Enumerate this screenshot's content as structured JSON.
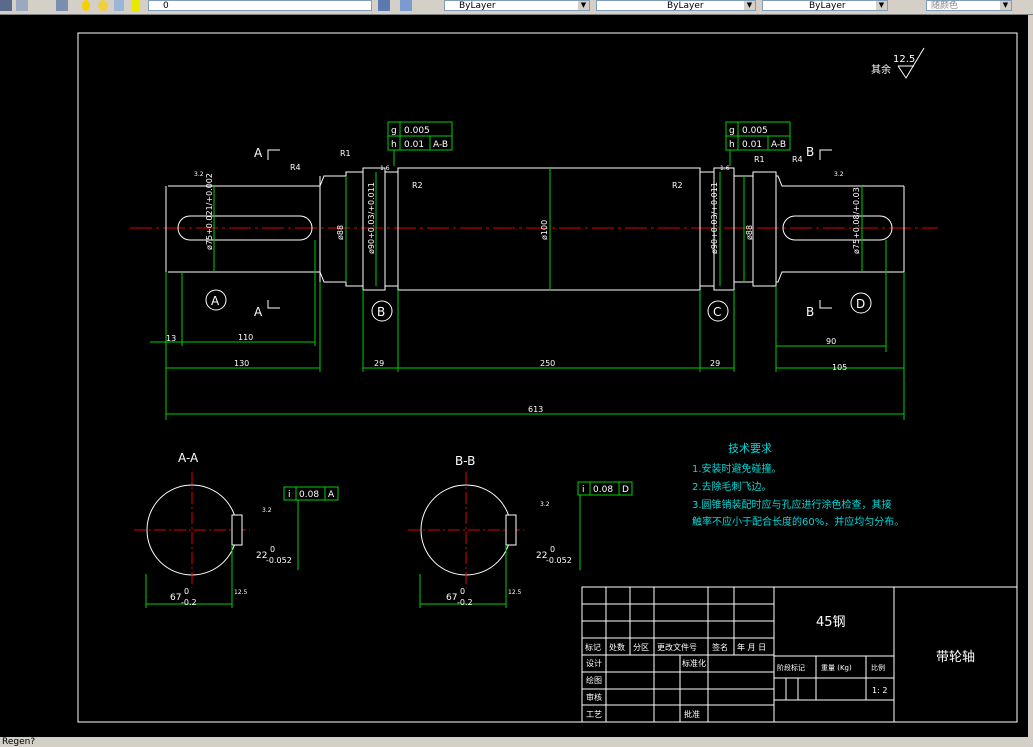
{
  "toolbar": {
    "layer_value": "0",
    "color_combo": "ByLayer",
    "linetype_combo": "ByLayer",
    "lineweight_combo": "ByLayer",
    "plotstyle_combo": "随颜色"
  },
  "drawing": {
    "roughness_note": {
      "prefix": "其余",
      "value": "12.5"
    },
    "section_marks": {
      "a_top": "A",
      "a_bottom": "A",
      "b_top": "B",
      "b_bottom": "B"
    },
    "datums": [
      "A",
      "B",
      "C",
      "D"
    ],
    "radii": {
      "r4_left": "R4",
      "r1_left": "R1",
      "r2_left": "R2",
      "r2_right": "R2",
      "r1_right": "R1",
      "r4_right": "R4"
    },
    "tolerance_left": {
      "row1_sym": "g",
      "row1_val": "0.005",
      "row2_sym": "h",
      "row2_val": "0.01",
      "row2_ref": "A-B"
    },
    "tolerance_right": {
      "row1_sym": "g",
      "row1_val": "0.005",
      "row2_sym": "h",
      "row2_val": "0.01",
      "row2_ref": "A-B"
    },
    "diameters": {
      "left_end": "ø75+0.021/+0.002",
      "left_shoulder": "ø88",
      "left_bearing": "ø90+0.03/+0.011",
      "middle": "ø100",
      "right_bearing": "ø90+0.03/+0.011",
      "right_shoulder": "ø88",
      "right_end": "ø75+0.08/+0.03"
    },
    "lengths": {
      "d13": "13",
      "d110": "110",
      "d130": "130",
      "d29_left": "29",
      "d250": "250",
      "d29_right": "29",
      "d90": "90",
      "d105": "105",
      "d613": "613"
    },
    "surface_marks": {
      "s1": "3.2",
      "s2": "1.6",
      "s3": "1.6",
      "s4": "3.2"
    },
    "section_aa": {
      "title": "A-A",
      "tol_sym": "i",
      "tol_val": "0.08",
      "tol_ref": "A",
      "depth_nominal": "22",
      "depth_upper": "0",
      "depth_lower": "-0.052",
      "width_nominal": "67",
      "width_upper": "0",
      "width_lower": "-0.2",
      "rough_left": "3.2",
      "rough_right": "12.5"
    },
    "section_bb": {
      "title": "B-B",
      "tol_sym": "i",
      "tol_val": "0.08",
      "tol_ref": "D",
      "depth_nominal": "22",
      "depth_upper": "0",
      "depth_lower": "-0.052",
      "width_nominal": "67",
      "width_upper": "0",
      "width_lower": "-0.2",
      "rough_left": "3.2",
      "rough_right": "12.5"
    },
    "tech_req": {
      "title": "技术要求",
      "items": [
        "1.安装时避免碰撞。",
        "2.去除毛刺飞边。",
        "3.圆锥销装配时应与孔应进行涂色检查，其接",
        "触率不应小于配合长度的60%，并应均匀分布。"
      ]
    },
    "title_block": {
      "material": "45钢",
      "part_name": "带轮轴",
      "header_row": [
        "标记",
        "处数",
        "分区",
        "更改文件号",
        "签名",
        "年 月 日"
      ],
      "design": "设计",
      "standardize": "标准化",
      "drawing": "绘图",
      "review": "审核",
      "process": "工艺",
      "approve": "批准",
      "stage_mark": "阶段标记",
      "weight": "重量 (Kg)",
      "scale_label": "比例",
      "scale_value": "1: 2"
    }
  },
  "status": {
    "prompt": "Regen?"
  }
}
